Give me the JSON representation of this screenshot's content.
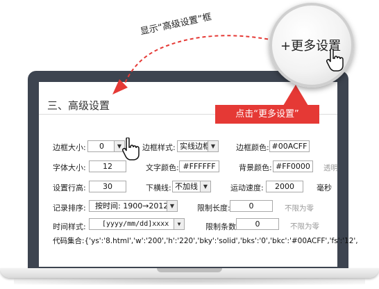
{
  "callout": {
    "arc_label": "显示“高级设置”框",
    "magnifier_label": "+更多设置",
    "badge_label": "点击“更多设置”"
  },
  "section": {
    "title": "三、高级设置"
  },
  "form": {
    "border_size_label": "边框大小:",
    "border_size_value": "0",
    "border_style_label": "边框样式:",
    "border_style_value": "实线边框",
    "border_color_label": "边框颜色:",
    "border_color_value": "#00ACFF",
    "font_size_label": "字体大小:",
    "font_size_value": "12",
    "text_color_label": "文字颜色:",
    "text_color_value": "#FFFFFF",
    "bg_color_label": "背景颜色:",
    "bg_color_value": "#FF0000",
    "transparent_label": "透明",
    "row_height_label": "设置行高:",
    "row_height_value": "30",
    "underline_label": "下横线:",
    "underline_value": "不加线",
    "speed_label": "运动速度:",
    "speed_value": "2000",
    "ms_label": "毫秒",
    "sort_label": "记录排序:",
    "sort_value": "按时间: 1900→2012",
    "limit_length_label": "限制长度:",
    "limit_length_value": "0",
    "unlimited_1": "不限为零",
    "time_style_label": "时间样式:",
    "time_style_value": "[yyyy/mm/dd]xxxx",
    "limit_count_label": "限制条数:",
    "limit_count_value": "0",
    "unlimited_2": "不限为零",
    "code_label": "代码集合:",
    "code_value": "{'ys':'8.html','w':'200','h':'220','bky':'solid','bks':'0','bkc':'#00ACFF','fs':'12',"
  },
  "colors": {
    "accent_red": "#e53935",
    "bezel": "#3d4450"
  },
  "icons": [
    "hand-cursor-icon",
    "dropdown-arrow-icon"
  ]
}
